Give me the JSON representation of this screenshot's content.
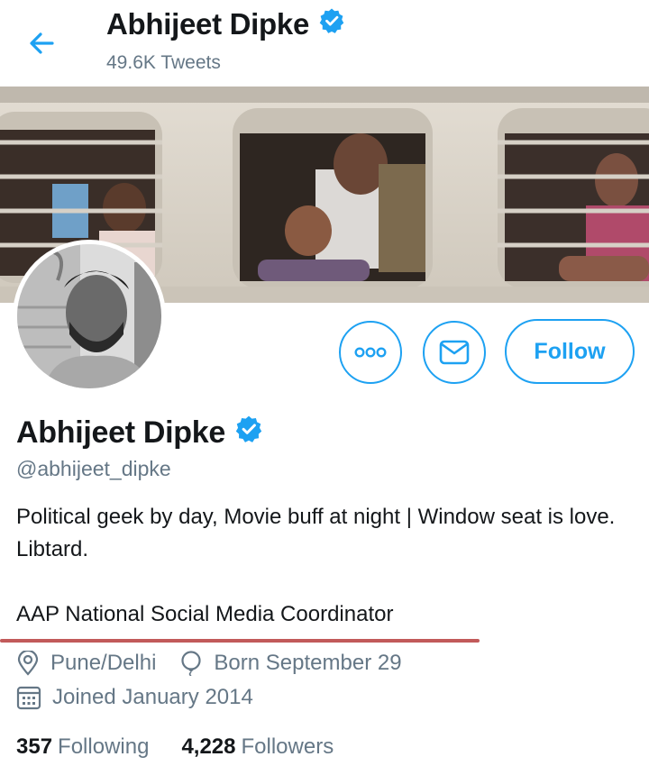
{
  "header": {
    "name": "Abhijeet Dipke",
    "tweet_count": "49.6K Tweets"
  },
  "profile": {
    "name": "Abhijeet Dipke",
    "handle": "@abhijeet_dipke",
    "bio": "Political geek by day, Movie buff at night | Window seat is love. Libtard.",
    "bio_line2": "AAP National Social Media Coordinator",
    "location": "Pune/Delhi",
    "birthday": "Born September 29",
    "joined": "Joined January 2014",
    "following_count": "357",
    "following_label": "Following",
    "followers_count": "4,228",
    "followers_label": "Followers"
  },
  "actions": {
    "follow_label": "Follow"
  },
  "icons": {
    "back": "arrow-left-icon",
    "verified": "verified-badge-icon",
    "more": "more-icon",
    "message": "envelope-icon",
    "location": "location-pin-icon",
    "birthday": "balloon-icon",
    "calendar": "calendar-icon"
  },
  "colors": {
    "accent": "#1da1f2",
    "secondary_text": "#657786",
    "annotation_underline": "#c25a5a"
  }
}
